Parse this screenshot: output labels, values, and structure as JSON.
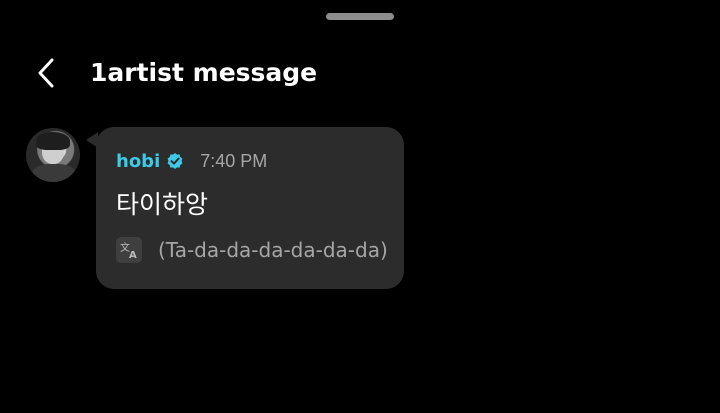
{
  "header": {
    "back_icon": "chevron-left-icon",
    "title": "1artist message"
  },
  "message": {
    "sender": "hobi",
    "verified_icon": "verified-badge-icon",
    "verified_color": "#3ec9e6",
    "time": "7:40 PM",
    "text": "타이하앙",
    "translate_icon": "translate-icon",
    "translation": "(Ta-da-da-da-da-da-da)"
  },
  "colors": {
    "background": "#000000",
    "bubble": "#2c2c2c",
    "sender": "#3ec9e6",
    "muted_text": "#a6a6a6"
  }
}
